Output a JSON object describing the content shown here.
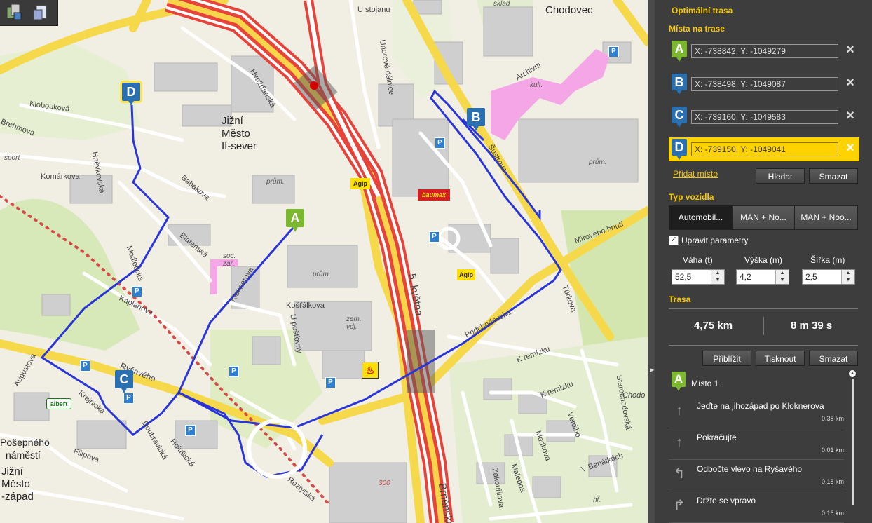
{
  "toolbar": {
    "icons": [
      "layers-icon",
      "print-preview-icon"
    ]
  },
  "map": {
    "districts": [
      {
        "name": "chodovec",
        "text": "Chodovec"
      },
      {
        "name": "jizni-mesto-ii",
        "lines": [
          "Jižní",
          "Město",
          "II-sever"
        ]
      },
      {
        "name": "posepneho",
        "lines": [
          "Pošepného",
          "náměstí"
        ]
      },
      {
        "name": "jizni-mesto-zapad",
        "lines": [
          "Jižní",
          "Město",
          "-západ"
        ]
      },
      {
        "name": "chodov-edge",
        "text": "Chodo"
      }
    ],
    "streets": [
      "U stojanu",
      "Hvožďanská",
      "Klobouková",
      "Brehmova",
      "Hněvkovská",
      "Komárkova",
      "Babakova",
      "Modletická",
      "Blatenská",
      "Kaplanova",
      "Kloknerova",
      "Košťálkova",
      "U pošťovny",
      "Augustova",
      "Ryšavého",
      "Krejnická",
      "Doubravická",
      "Holušická",
      "Filipova",
      "Roztylská",
      "5. května",
      "Brněnská",
      "Podchodovská",
      "Türkova",
      "Mírového hnutí",
      "K remízku",
      "Starochodovská",
      "Medkova",
      "Malebná",
      "Verdiho",
      "Zakouřilova",
      "V Benátkách",
      "Archivní",
      "Unorové dálnice",
      "Šustrova",
      "Komárkova ",
      "K remizku",
      "sport",
      "kult.",
      "prům.",
      "soc. zař.",
      "zem. vdj.",
      "hř.",
      "sklad",
      "300"
    ],
    "markers": [
      {
        "letter": "A",
        "color": "green"
      },
      {
        "letter": "B",
        "color": "blue"
      },
      {
        "letter": "C",
        "color": "blue"
      },
      {
        "letter": "D",
        "color": "blue"
      }
    ],
    "pois": {
      "agip1": "Agip",
      "agip2": "Agip",
      "baumax": "baumax",
      "albert": "albert"
    },
    "route_color": "#2a35d8"
  },
  "panel": {
    "title": "Optimální trasa",
    "section_places": "Místa na trase",
    "waypoints": [
      {
        "letter": "A",
        "value": "X: -738842, Y: -1049279",
        "color": "#7cb82f"
      },
      {
        "letter": "B",
        "value": "X: -738498, Y: -1049087",
        "color": "#2a6fb0"
      },
      {
        "letter": "C",
        "value": "X: -739160, Y: -1049583",
        "color": "#2a6fb0"
      },
      {
        "letter": "D",
        "value": "X: -739150, Y: -1049041",
        "color": "#2a6fb0"
      }
    ],
    "close_glyph": "✕",
    "add_place": "Přidat místo",
    "search_btn": "Hledat",
    "clear_btn": "Smazat",
    "section_vehicle": "Typ vozidla",
    "vehicles": [
      "Automobil...",
      "MAN + No...",
      "MAN + Noo..."
    ],
    "adjust_params": "Upravit parametry",
    "param_labels": {
      "weight": "Váha (t)",
      "height": "Výška (m)",
      "width": "Šířka (m)"
    },
    "param_values": {
      "weight": "52,5",
      "height": "4,2",
      "width": "2,5"
    },
    "section_route": "Trasa",
    "distance": "4,75 km",
    "duration": "8 m 39 s",
    "zoom_btn": "Přiblížit",
    "print_btn": "Tisknout",
    "delete_btn": "Smazat",
    "place1_letter": "A",
    "place1_label": "Místo 1",
    "steps": [
      {
        "icon": "arrow-up-icon",
        "text": "Jeďte na jihozápad po Kloknerova",
        "dist": "0,38 km"
      },
      {
        "icon": "arrow-up-icon",
        "text": "Pokračujte",
        "dist": "0,01 km"
      },
      {
        "icon": "turn-left-icon",
        "text": "Odbočte vlevo na Ryšavého",
        "dist": "0,18 km"
      },
      {
        "icon": "keep-right-icon",
        "text": "Držte se vpravo",
        "dist": "0,16 km"
      }
    ],
    "accent_color": "#f5c800"
  }
}
